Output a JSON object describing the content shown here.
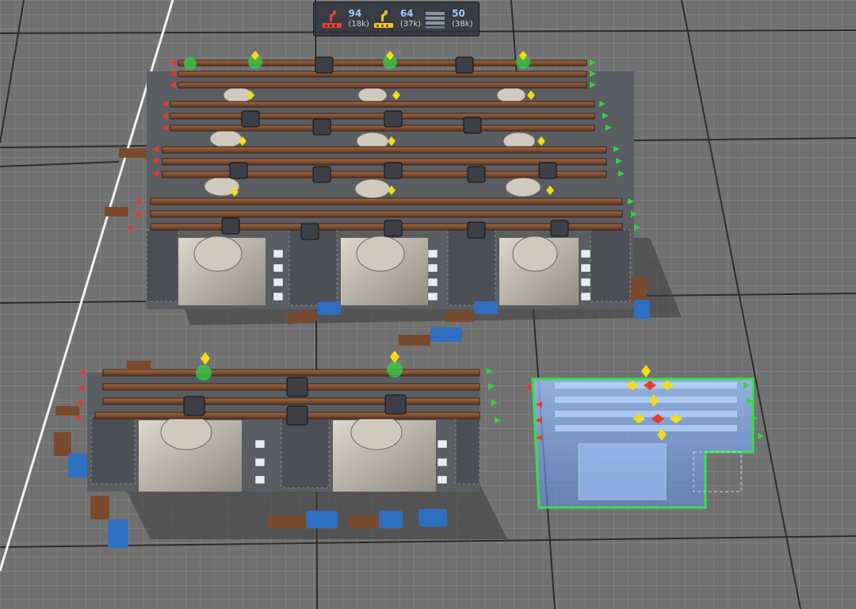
{
  "hud": {
    "counters": [
      {
        "icon": "red-assembler-icon",
        "value": "94",
        "sub": "(18k)",
        "color": "#e2453c"
      },
      {
        "icon": "yellow-assembler-icon",
        "value": "64",
        "sub": "(37k)",
        "color": "#f0c52a"
      },
      {
        "icon": "conveyor-stack-icon",
        "value": "50",
        "sub": "(38k)",
        "color": "#8c93a3"
      }
    ]
  },
  "scene": {
    "colors": {
      "floor": "#717171",
      "grid_minor": "#8a8a8a",
      "grid_major": "#2b2b2b",
      "belt": "#7a4a2e",
      "machine": "#c9c5b8",
      "tower": "#a7acb4",
      "ghost": "#6fa8ff",
      "port_in": "#e8392b",
      "port_out": "#30d63c",
      "marker": "#f3dc1a",
      "truck": "#2f6fc2"
    }
  }
}
